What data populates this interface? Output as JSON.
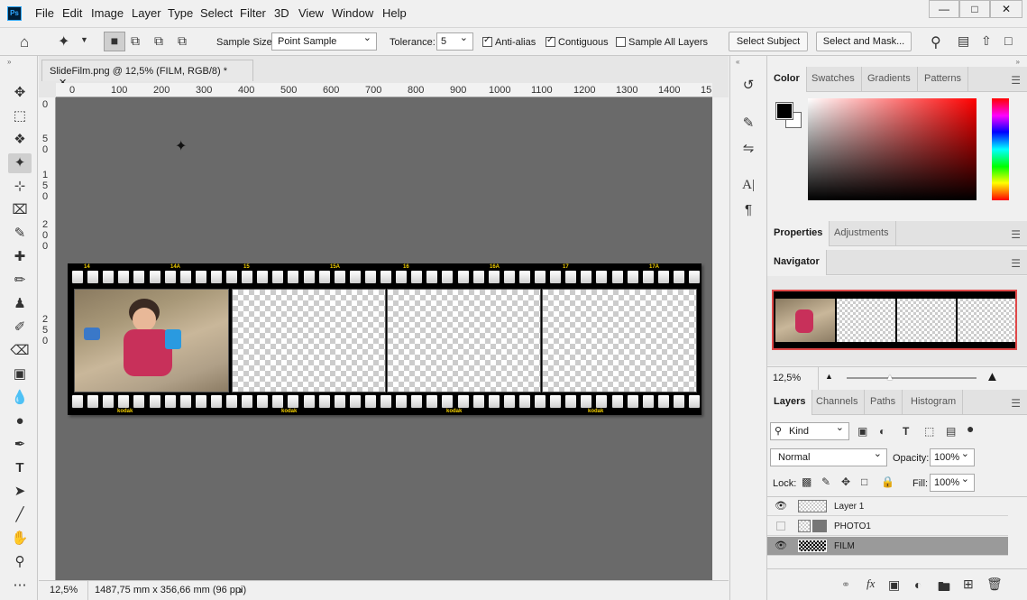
{
  "menubar": {
    "app_icon": "Ps",
    "items": [
      "File",
      "Edit",
      "Image",
      "Layer",
      "Type",
      "Select",
      "Filter",
      "3D",
      "View",
      "Window",
      "Help"
    ],
    "window_controls": [
      "minimize-icon",
      "maximize-icon",
      "close-icon"
    ]
  },
  "options": {
    "sample_size_label": "Sample Size:",
    "sample_size_value": "Point Sample",
    "tolerance_label": "Tolerance:",
    "tolerance_value": "5",
    "antialias_label": "Anti-alias",
    "antialias_checked": true,
    "contiguous_label": "Contiguous",
    "contiguous_checked": true,
    "sample_all_label": "Sample All Layers",
    "sample_all_checked": false,
    "select_subject": "Select Subject",
    "select_mask": "Select and Mask..."
  },
  "document": {
    "tab_title": "SlideFilm.png @ 12,5% (FILM, RGB/8) *",
    "ruler_top": [
      "0",
      "100",
      "200",
      "300",
      "400",
      "500",
      "600",
      "700",
      "800",
      "900",
      "1000",
      "1100",
      "1200",
      "1300",
      "1400",
      "15"
    ],
    "ruler_left": [
      "0",
      "5",
      "0",
      "1",
      "5",
      "0",
      "2",
      "0",
      "0",
      "2",
      "5",
      "0"
    ],
    "film_edge_top": [
      "14",
      "14A",
      "15",
      "15A",
      "16",
      "16A",
      "17",
      "17A"
    ],
    "film_edge_bottom": [
      "kodak",
      "kodak",
      "kodak",
      "kodak"
    ]
  },
  "status": {
    "zoom": "12,5%",
    "dimensions": "1487,75 mm x 356,66 mm (96 ppi)",
    "arrow": "›"
  },
  "panels": {
    "color_tabs": [
      "Color",
      "Swatches",
      "Gradients",
      "Patterns"
    ],
    "properties_tabs": [
      "Properties",
      "Adjustments"
    ],
    "navigator_tab": "Navigator",
    "navigator_zoom": "12,5%",
    "layers_tabs": [
      "Layers",
      "Channels",
      "Paths",
      "Histogram"
    ],
    "filter_kind": "Kind",
    "blend_mode": "Normal",
    "opacity_label": "Opacity:",
    "opacity_value": "100%",
    "lock_label": "Lock:",
    "fill_label": "Fill:",
    "fill_value": "100%",
    "layers": [
      {
        "name": "Layer 1",
        "visible": true
      },
      {
        "name": "PHOTO1",
        "visible": false
      },
      {
        "name": "FILM",
        "visible": true
      }
    ]
  },
  "colors": {
    "foreground": "#000000",
    "background": "#ffffff",
    "picker_hue": "#ff0000"
  }
}
